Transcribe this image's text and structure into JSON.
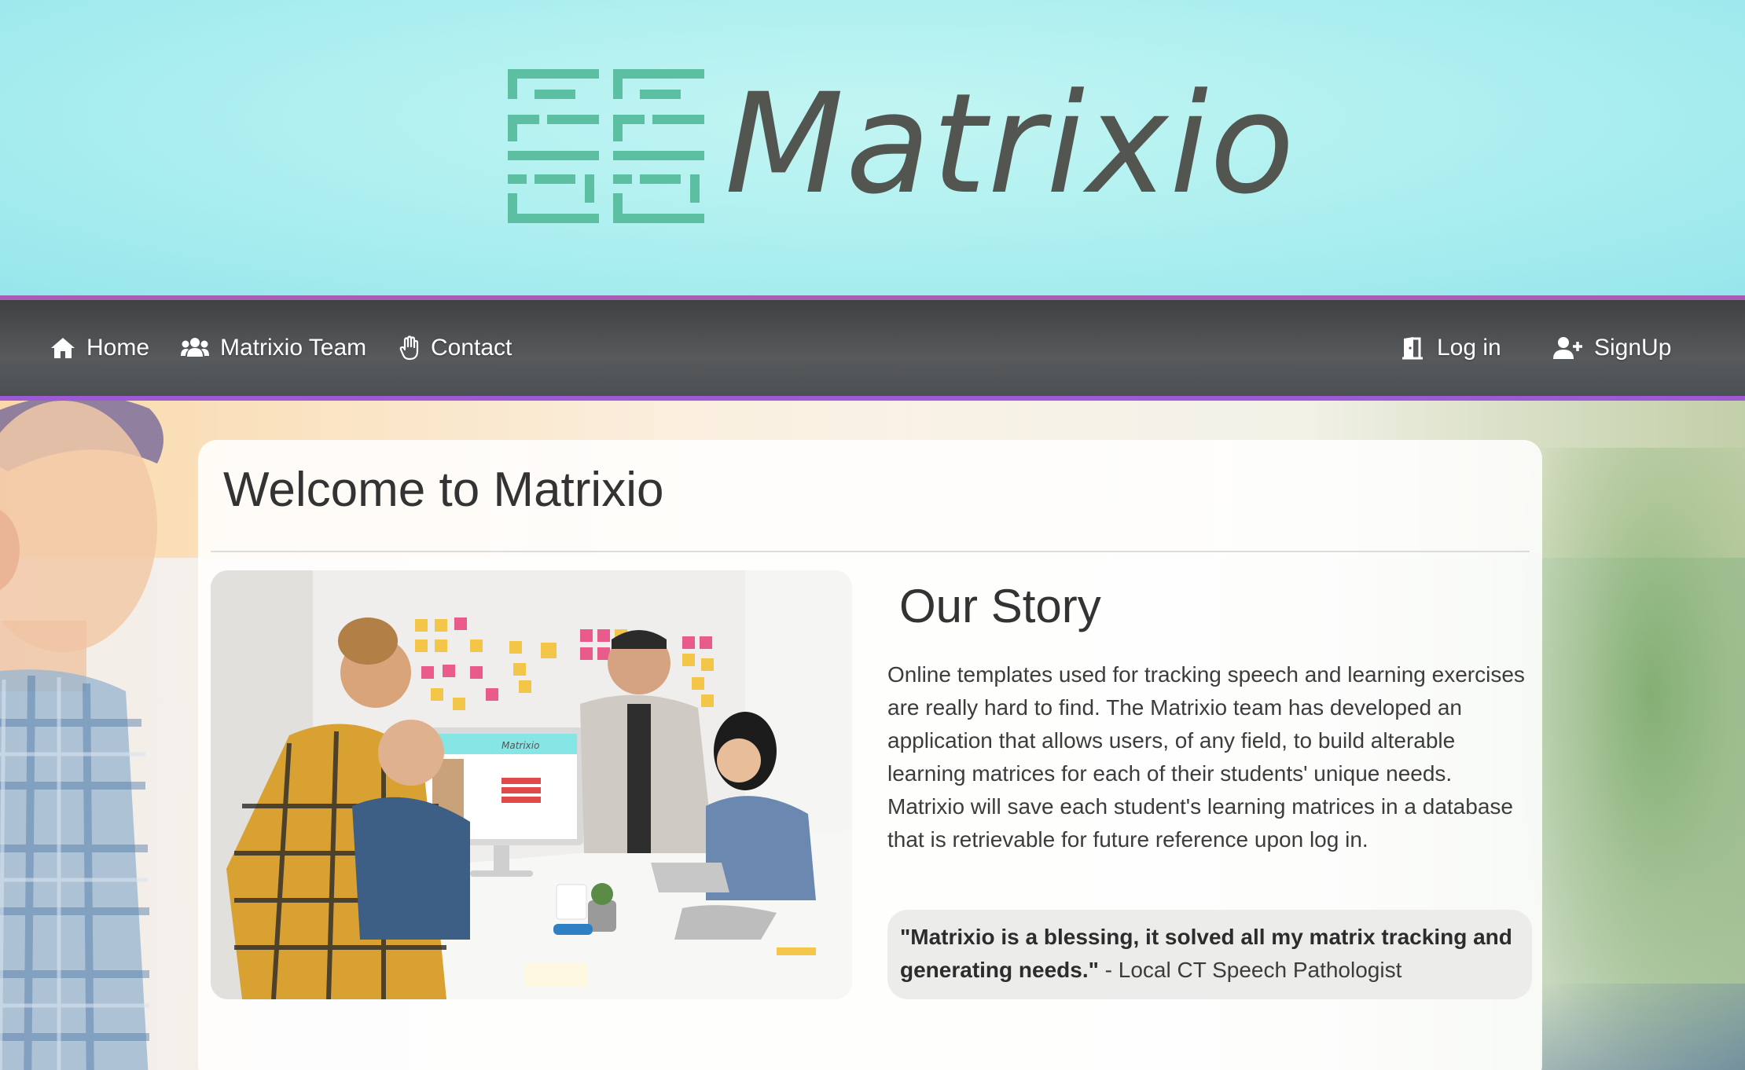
{
  "brand": {
    "name": "Matrixio",
    "logo_icon": "matrix-grid-logo",
    "logo_color": "#5cbfa1",
    "text_color": "#525550"
  },
  "nav": {
    "left": [
      {
        "label": "Home",
        "icon": "home-icon"
      },
      {
        "label": "Matrixio Team",
        "icon": "users-icon"
      },
      {
        "label": "Contact",
        "icon": "hand-icon"
      }
    ],
    "right": [
      {
        "label": "Log in",
        "icon": "door-icon"
      },
      {
        "label": "SignUp",
        "icon": "user-plus-icon"
      }
    ],
    "accent_color": "#a65eb3"
  },
  "main": {
    "title": "Welcome to Matrixio",
    "story": {
      "heading": "Our Story",
      "body": "Online templates used for tracking speech and learning exercises are really hard to find. The Matrixio team has developed an application that allows users, of any field, to build alterable learning matrices for each of their students' unique needs. Matrixio will save each student's learning matrices in a database that is retrievable for future reference upon log in.",
      "quote": "\"Matrixio is a blessing, it solved all my matrix tracking and generating needs.\"",
      "quote_source": " - Local CT Speech Pathologist"
    },
    "photo": {
      "screen_brand": "Matrixio"
    }
  }
}
